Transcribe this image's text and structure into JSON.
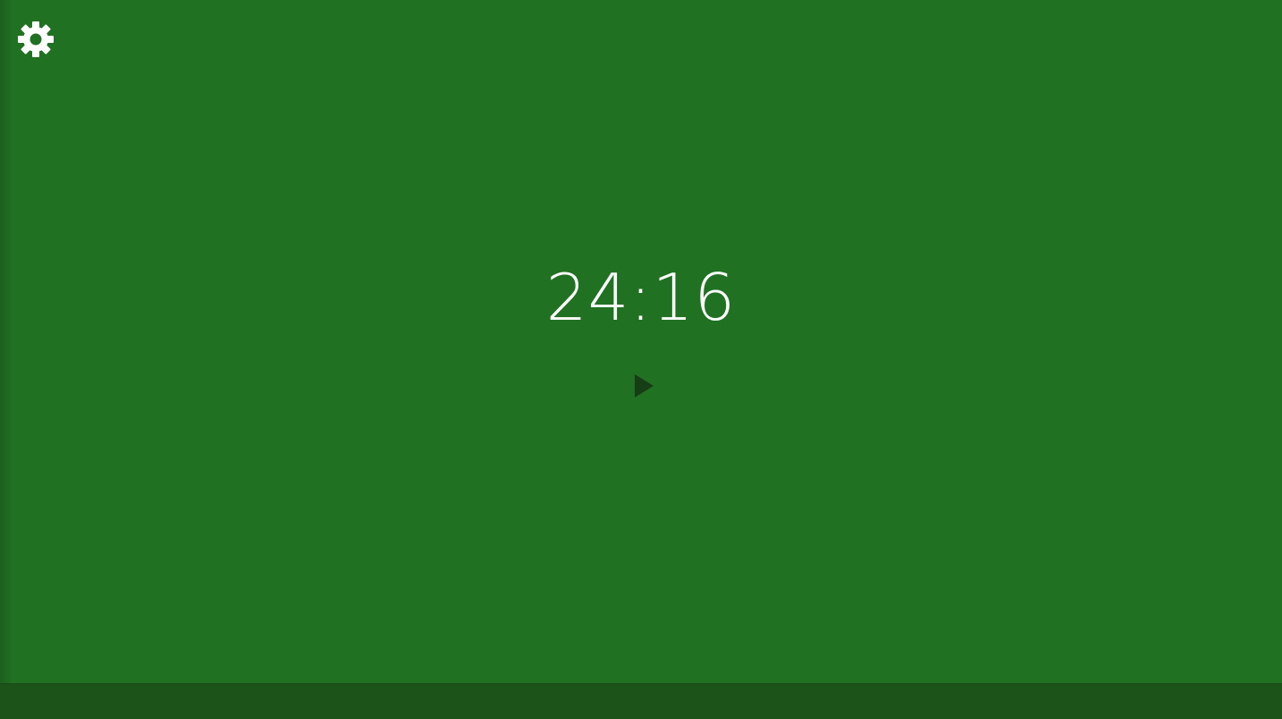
{
  "timer": {
    "display": "24:16"
  },
  "icons": {
    "settings": "gear-icon",
    "play": "play-icon"
  },
  "colors": {
    "background": "#217123",
    "bottom_bar": "#1c5319",
    "text": "#ffffff",
    "play_icon": "#163d15"
  }
}
